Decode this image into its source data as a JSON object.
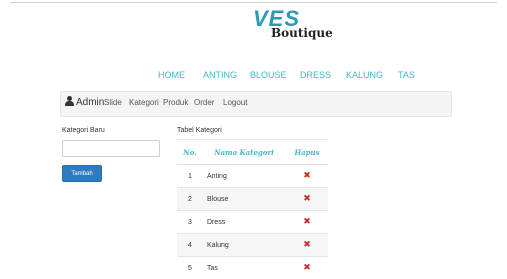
{
  "brand": {
    "logo_top": "VES",
    "logo_bottom": "Boutique"
  },
  "menu": [
    {
      "label": "HOME"
    },
    {
      "label": "ANTING"
    },
    {
      "label": "BLOUSE"
    },
    {
      "label": "DRESS"
    },
    {
      "label": "KALUNG"
    },
    {
      "label": "TAS"
    }
  ],
  "admin_nav": {
    "user_label": "Admin",
    "items": [
      {
        "label": "Slide"
      },
      {
        "label": "Kategori"
      },
      {
        "label": "Produk"
      },
      {
        "label": "Order"
      },
      {
        "label": "Logout"
      }
    ]
  },
  "form": {
    "label": "Kategori Baru",
    "input_value": "",
    "input_placeholder": "",
    "button_label": "Tambah"
  },
  "table": {
    "title": "Tabel Kategori",
    "headers": {
      "no": "No.",
      "name": "Nama Kategori",
      "delete": "Hapus"
    },
    "rows": [
      {
        "no": "1",
        "name": "Anting"
      },
      {
        "no": "2",
        "name": "Blouse"
      },
      {
        "no": "3",
        "name": "Dress"
      },
      {
        "no": "4",
        "name": "Kalung"
      },
      {
        "no": "5",
        "name": "Tas"
      }
    ],
    "delete_icon": "x-icon"
  },
  "colors": {
    "accent": "#4ab4c8",
    "button": "#2e7cbf",
    "delete": "#c9302c"
  }
}
